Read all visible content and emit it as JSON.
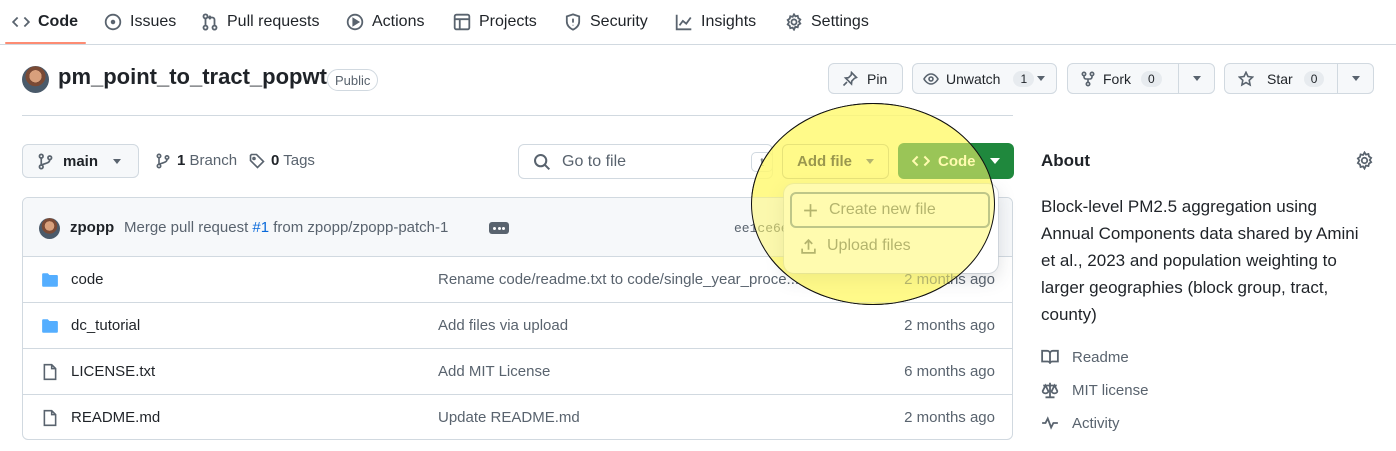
{
  "nav": {
    "tabs": [
      {
        "label": "Code",
        "icon": "code-icon"
      },
      {
        "label": "Issues",
        "icon": "issue-circle-icon"
      },
      {
        "label": "Pull requests",
        "icon": "pull-request-icon"
      },
      {
        "label": "Actions",
        "icon": "play-circle-icon"
      },
      {
        "label": "Projects",
        "icon": "table-icon"
      },
      {
        "label": "Security",
        "icon": "shield-icon"
      },
      {
        "label": "Insights",
        "icon": "graph-icon"
      },
      {
        "label": "Settings",
        "icon": "gear-icon"
      }
    ]
  },
  "repo": {
    "name": "pm_point_to_tract_popwt",
    "visibility": "Public",
    "pin_label": "Pin",
    "watch_label": "Unwatch",
    "watch_count": "1",
    "fork_label": "Fork",
    "fork_count": "0",
    "star_label": "Star",
    "star_count": "0"
  },
  "filenav": {
    "branch": "main",
    "branch_count": "1",
    "branch_label": "Branch",
    "tag_count": "0",
    "tag_label": "Tags",
    "search_placeholder": "Go to file",
    "search_shortcut": "t",
    "add_file_label": "Add file",
    "code_label": "Code"
  },
  "add_file_menu": {
    "items": [
      {
        "label": "Create new file",
        "icon": "plus-icon"
      },
      {
        "label": "Upload files",
        "icon": "upload-icon"
      }
    ]
  },
  "latest_commit": {
    "author": "zpopp",
    "message_prefix": "Merge pull request ",
    "pr": "#1",
    "message_suffix": " from zpopp/zpopp-patch-1",
    "hash": "ee1ce6e"
  },
  "files": [
    {
      "name": "code",
      "type": "folder",
      "commit": "Rename code/readme.txt to code/single_year_process/readme.txt",
      "date": "2 months ago"
    },
    {
      "name": "dc_tutorial",
      "type": "folder",
      "commit": "Add files via upload",
      "date": "2 months ago"
    },
    {
      "name": "LICENSE.txt",
      "type": "file",
      "commit": "Add MIT License",
      "date": "6 months ago"
    },
    {
      "name": "README.md",
      "type": "file",
      "commit": "Update README.md",
      "date": "2 months ago"
    }
  ],
  "about": {
    "title": "About",
    "description": "Block-level PM2.5 aggregation using Annual Components data shared by Amini et al., 2023 and population weighting to larger geographies (block group, tract, county)",
    "links": [
      {
        "label": "Readme",
        "icon": "book-icon"
      },
      {
        "label": "MIT license",
        "icon": "law-scale-icon"
      },
      {
        "label": "Activity",
        "icon": "pulse-icon"
      }
    ]
  },
  "colors": {
    "accent_underline": "#fd8c73",
    "code_button": "#1f883d",
    "link_blue": "#0969da",
    "folder_blue": "#54aeff",
    "highlight_yellow": "#fff878"
  }
}
